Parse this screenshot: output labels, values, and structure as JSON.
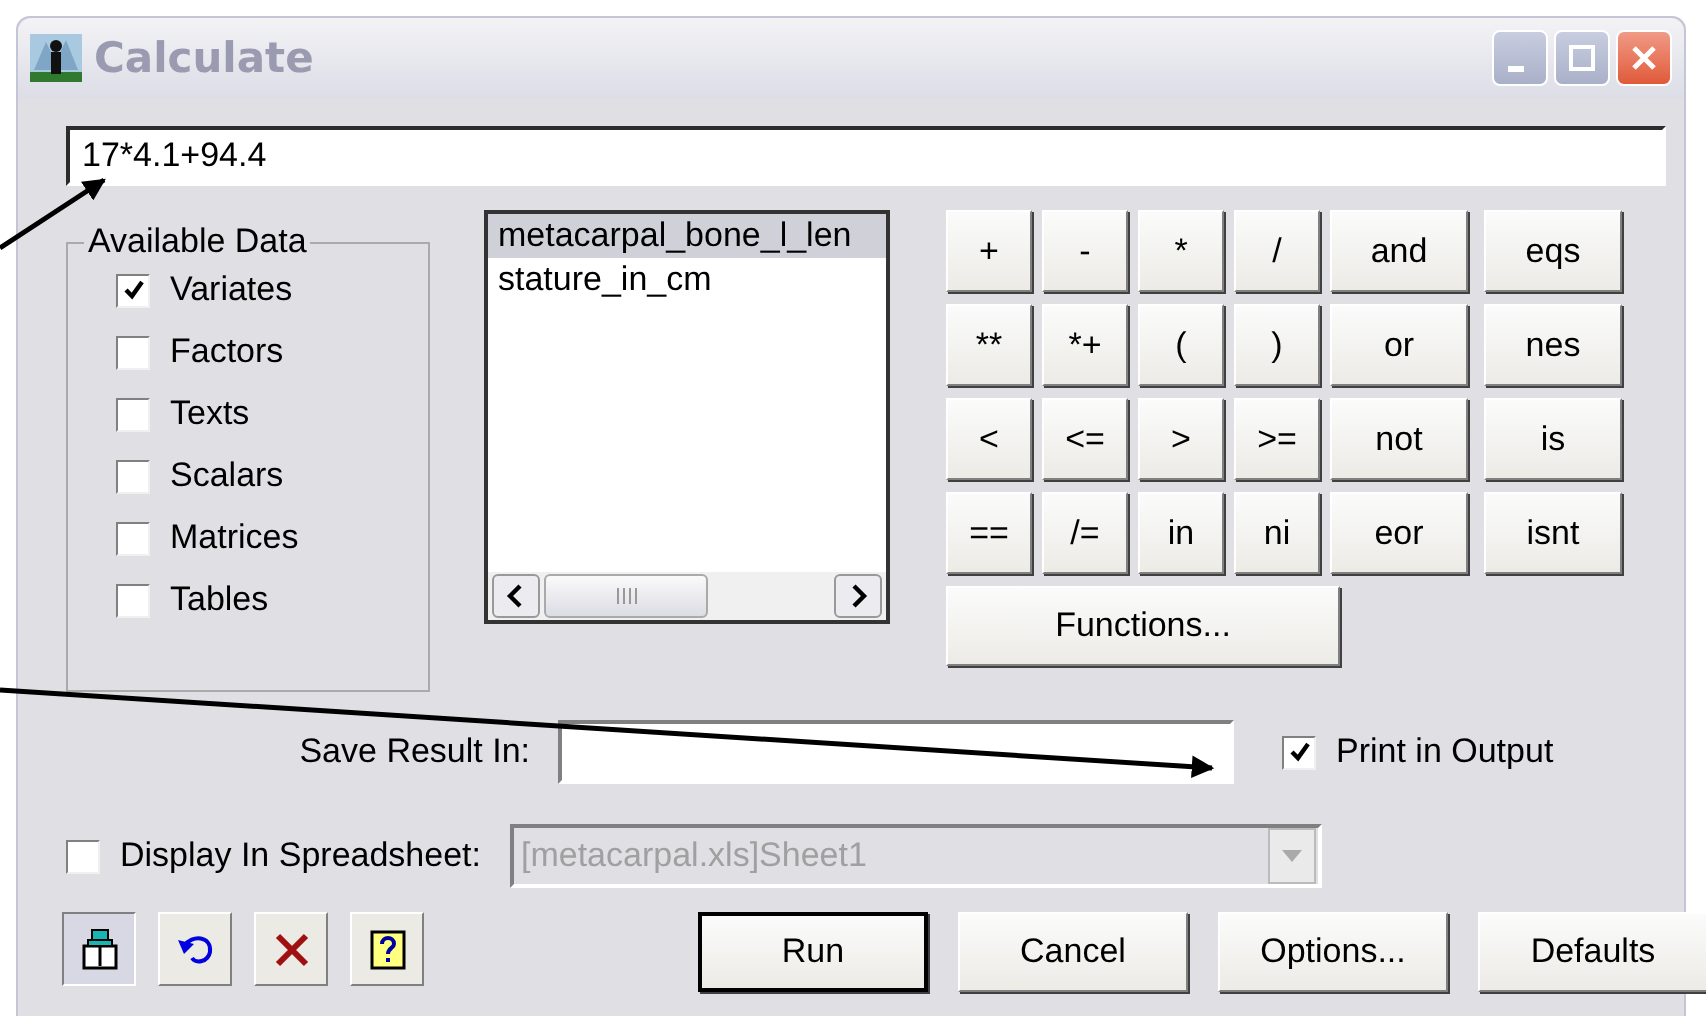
{
  "window": {
    "title": "Calculate",
    "active": false
  },
  "expression": {
    "value": "17*4.1+94.4"
  },
  "available_data": {
    "title": "Available Data",
    "items": [
      {
        "label": "Variates",
        "checked": true
      },
      {
        "label": "Factors",
        "checked": false
      },
      {
        "label": "Texts",
        "checked": false
      },
      {
        "label": "Scalars",
        "checked": false
      },
      {
        "label": "Matrices",
        "checked": false
      },
      {
        "label": "Tables",
        "checked": false
      }
    ]
  },
  "data_list": {
    "items": [
      {
        "label": "metacarpal_bone_l_len",
        "selected": true
      },
      {
        "label": "stature_in_cm",
        "selected": false
      }
    ]
  },
  "operators": [
    {
      "label": "+",
      "kind": "small"
    },
    {
      "label": "-",
      "kind": "small"
    },
    {
      "label": "*",
      "kind": "small"
    },
    {
      "label": "/",
      "kind": "small"
    },
    {
      "label": "and",
      "kind": "wide"
    },
    {
      "label": "eqs",
      "kind": "wide"
    },
    {
      "label": "**",
      "kind": "small"
    },
    {
      "label": "*+",
      "kind": "small"
    },
    {
      "label": "(",
      "kind": "small"
    },
    {
      "label": ")",
      "kind": "small"
    },
    {
      "label": "or",
      "kind": "wide"
    },
    {
      "label": "nes",
      "kind": "wide"
    },
    {
      "label": "<",
      "kind": "small"
    },
    {
      "label": "<=",
      "kind": "small"
    },
    {
      "label": ">",
      "kind": "small"
    },
    {
      "label": ">=",
      "kind": "small"
    },
    {
      "label": "not",
      "kind": "wide"
    },
    {
      "label": "is",
      "kind": "wide"
    },
    {
      "label": "==",
      "kind": "small"
    },
    {
      "label": "/=",
      "kind": "small"
    },
    {
      "label": "in",
      "kind": "small"
    },
    {
      "label": "ni",
      "kind": "small"
    },
    {
      "label": "eor",
      "kind": "wide"
    },
    {
      "label": "isnt",
      "kind": "wide"
    }
  ],
  "functions_button": "Functions...",
  "save_result": {
    "label": "Save Result In:"
  },
  "print_in_output": {
    "label": "Print in Output",
    "checked": true
  },
  "display_in_spreadsheet": {
    "label": "Display In Spreadsheet:",
    "checked": false
  },
  "sheet": {
    "value": "[metacarpal.xls]Sheet1",
    "disabled": true
  },
  "buttons": [
    {
      "label": "Run",
      "default": true
    },
    {
      "label": "Cancel",
      "default": false
    },
    {
      "label": "Options...",
      "default": false
    },
    {
      "label": "Defaults",
      "default": false
    }
  ]
}
